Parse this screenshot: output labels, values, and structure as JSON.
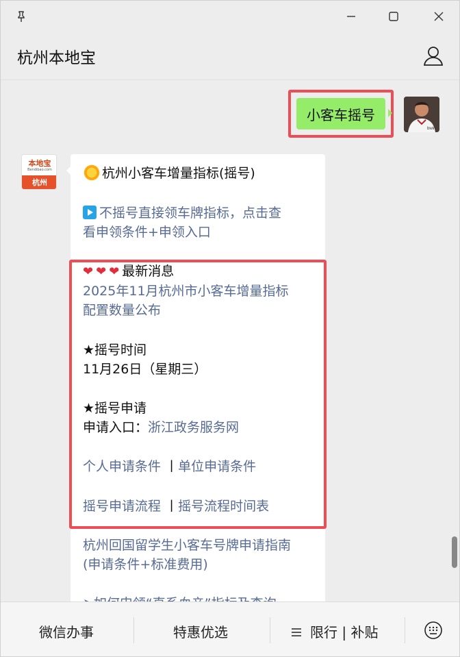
{
  "window": {
    "title": "杭州本地宝"
  },
  "sent": {
    "text": "小客车摇号"
  },
  "received": {
    "header": "杭州小客车增量指标(摇号)",
    "link1_line1": "不摇号直接领车牌指标，点击查",
    "link1_line2": "看申领条件+申领入口",
    "latest_label": "最新消息",
    "news_line1": "2025年11月杭州市小客车增量指标",
    "news_line2": "配置数量公布",
    "draw_time_label": "★摇号时间",
    "draw_time_value": "11月26日（星期三）",
    "apply_label": "★摇号申请",
    "apply_entry_prefix": "申请入口：",
    "apply_entry_link": "浙江政务服务网",
    "personal_condition": "个人申请条件",
    "separator": "丨",
    "company_condition": "单位申请条件",
    "process": "摇号申请流程",
    "schedule": "摇号流程时间表",
    "guide_line1": "杭州回国留学生小客车号牌申请指南",
    "guide_line2": "(申请条件+标准费用)",
    "partial_line": "➤如何申领“直系血亲”指标及查询"
  },
  "avatar": {
    "logo_text": "本地宝",
    "logo_sub": "Bendibao.com",
    "city": "杭州"
  },
  "bottom_menu": {
    "item1": "微信办事",
    "item2": "特惠优选",
    "item3": "限行 | 补贴"
  },
  "colors": {
    "sent_bubble": "#95ec69",
    "link": "#576b95",
    "highlight_border": "#ee4d55"
  }
}
